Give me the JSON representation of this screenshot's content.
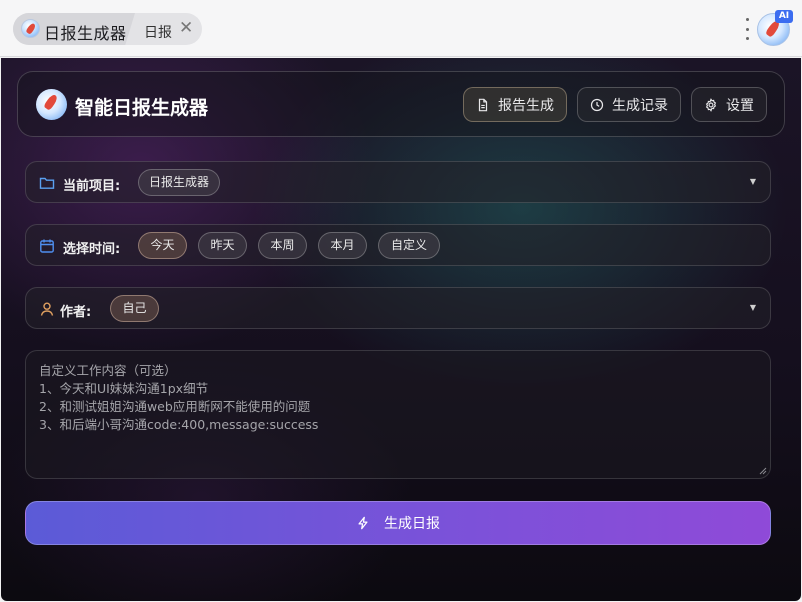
{
  "browser": {
    "tab_active_title": "日报生成器",
    "tab_second_title": "日报",
    "tab_close_glyph": "✕",
    "ai_badge": "AI"
  },
  "header": {
    "title": "智能日报生成器",
    "buttons": [
      {
        "label": "报告生成",
        "icon": "document-icon",
        "active": true
      },
      {
        "label": "生成记录",
        "icon": "clock-icon",
        "active": false
      },
      {
        "label": "设置",
        "icon": "gear-icon",
        "active": false
      }
    ]
  },
  "project": {
    "label": "当前项目:",
    "value": "日报生成器"
  },
  "time": {
    "label": "选择时间:",
    "options": [
      "今天",
      "昨天",
      "本周",
      "本月",
      "自定义"
    ],
    "selected": "今天"
  },
  "author": {
    "label": "作者:",
    "value": "自己"
  },
  "content": {
    "lines": [
      "自定义工作内容（可选）",
      "1、今天和UI妹妹沟通1px细节",
      "2、和测试姐姐沟通web应用断网不能使用的问题",
      "3、和后端小哥沟通code:400,message:success"
    ]
  },
  "generate_button": {
    "label": "生成日报",
    "icon": "lightning-icon"
  },
  "colors": {
    "button_gradient_start": "#5b5bd7",
    "button_gradient_end": "#8f4ad8",
    "folder_icon": "#5aa0f0",
    "calendar_icon": "#4f8ff0",
    "person_icon": "#e0a060"
  }
}
